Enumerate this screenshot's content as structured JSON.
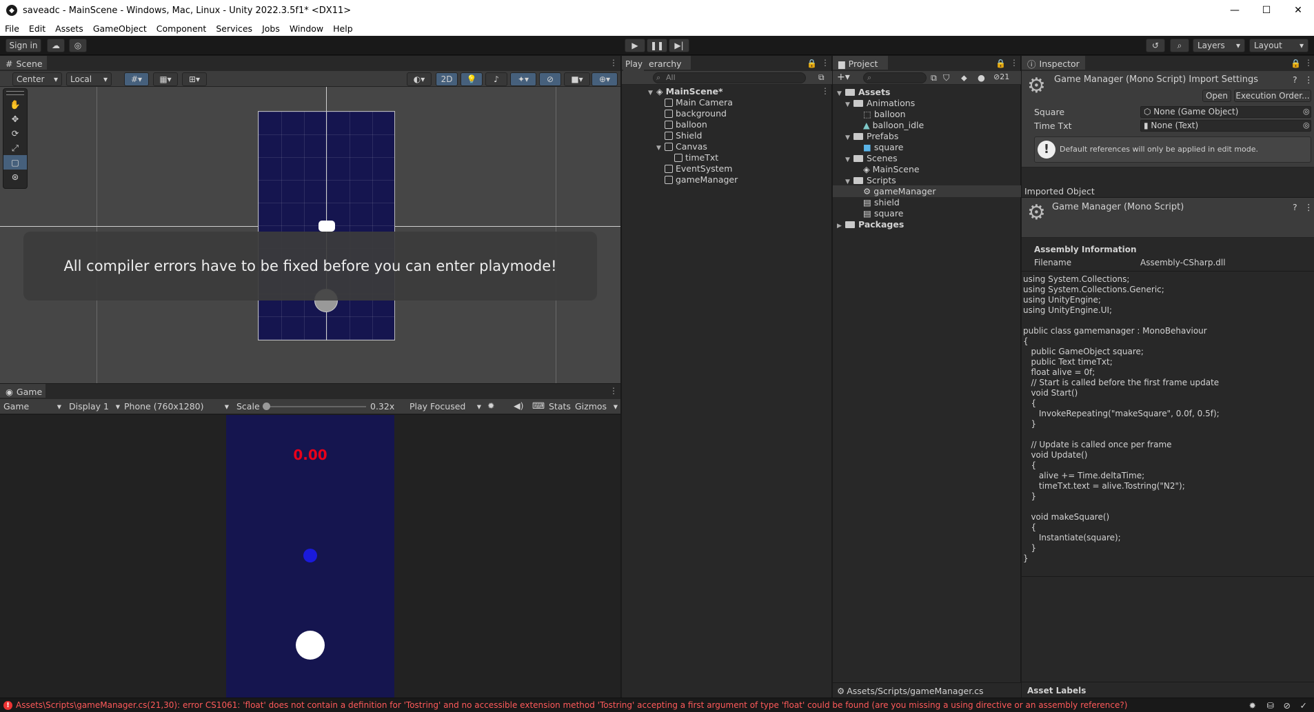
{
  "window": {
    "title": "saveadc - MainScene - Windows, Mac, Linux - Unity 2022.3.5f1* <DX11>"
  },
  "menu": [
    "File",
    "Edit",
    "Assets",
    "GameObject",
    "Component",
    "Services",
    "Jobs",
    "Window",
    "Help"
  ],
  "toolbar": {
    "sign_in": "Sign in",
    "layers": "Layers",
    "layout": "Layout"
  },
  "scene": {
    "tab": "Scene",
    "pivot": "Center",
    "space": "Local",
    "mode_2d": "2D",
    "error_message": "All compiler errors have to be fixed before you can enter playmode!"
  },
  "game": {
    "tab": "Game",
    "view": "Game",
    "display": "Display 1",
    "resolution": "Phone (760x1280)",
    "scale_label": "Scale",
    "scale_value": "0.32x",
    "play_focused": "Play Focused",
    "stats": "Stats",
    "gizmos": "Gizmos",
    "timer_text": "0.00"
  },
  "hierarchy": {
    "tab": "Hierarchy",
    "tab_visible": "erarchy",
    "play_overlay": "Play",
    "search_placeholder": "All",
    "scene": "MainScene*",
    "items": [
      "Main Camera",
      "background",
      "balloon",
      "Shield",
      "Canvas",
      "timeTxt",
      "EventSystem",
      "gameManager"
    ]
  },
  "project": {
    "tab": "Project",
    "hidden_count": "21",
    "assets": "Assets",
    "animations": "Animations",
    "animation_items": [
      "balloon",
      "balloon_idle"
    ],
    "prefabs": "Prefabs",
    "prefab_items": [
      "square"
    ],
    "scenes": "Scenes",
    "scene_items": [
      "MainScene"
    ],
    "scripts": "Scripts",
    "script_items": [
      "gameManager",
      "shield",
      "square"
    ],
    "packages": "Packages",
    "footer_path": "Assets/Scripts/gameManager.cs"
  },
  "inspector": {
    "tab": "Inspector",
    "header_title": "Game Manager (Mono Script) Import Settings",
    "open_button": "Open",
    "execution_order_button": "Execution Order...",
    "fields": [
      {
        "label": "Square",
        "value": "None (Game Object)"
      },
      {
        "label": "Time Txt",
        "value": "None (Text)"
      }
    ],
    "help_box": "Default references will only be applied in edit mode.",
    "imported_object": "Imported Object",
    "script_title": "Game Manager (Mono Script)",
    "assembly_information": "Assembly Information",
    "filename_label": "Filename",
    "filename_value": "Assembly-CSharp.dll",
    "code": "using System.Collections;\nusing System.Collections.Generic;\nusing UnityEngine;\nusing UnityEngine.UI;\n\npublic class gamemanager : MonoBehaviour\n{\n   public GameObject square;\n   public Text timeTxt;\n   float alive = 0f;\n   // Start is called before the first frame update\n   void Start()\n   {\n      InvokeRepeating(\"makeSquare\", 0.0f, 0.5f);\n   }\n\n   // Update is called once per frame\n   void Update()\n   {\n      alive += Time.deltaTime;\n      timeTxt.text = alive.Tostring(\"N2\");\n   }\n\n   void makeSquare()\n   {\n      Instantiate(square);\n   }\n}",
    "asset_labels": "Asset Labels"
  },
  "status": {
    "error": "Assets\\Scripts\\gameManager.cs(21,30): error CS1061: 'float' does not contain a definition for 'Tostring' and no accessible extension method 'Tostring' accepting a first argument of type 'float' could be found (are you missing a using directive or an assembly reference?)"
  },
  "colors": {
    "game_bg": "#15154f",
    "scene_sprite": "#15154f",
    "timer": "#e8001a",
    "error": "#ff5a5a",
    "ball": "#1a1adb"
  }
}
